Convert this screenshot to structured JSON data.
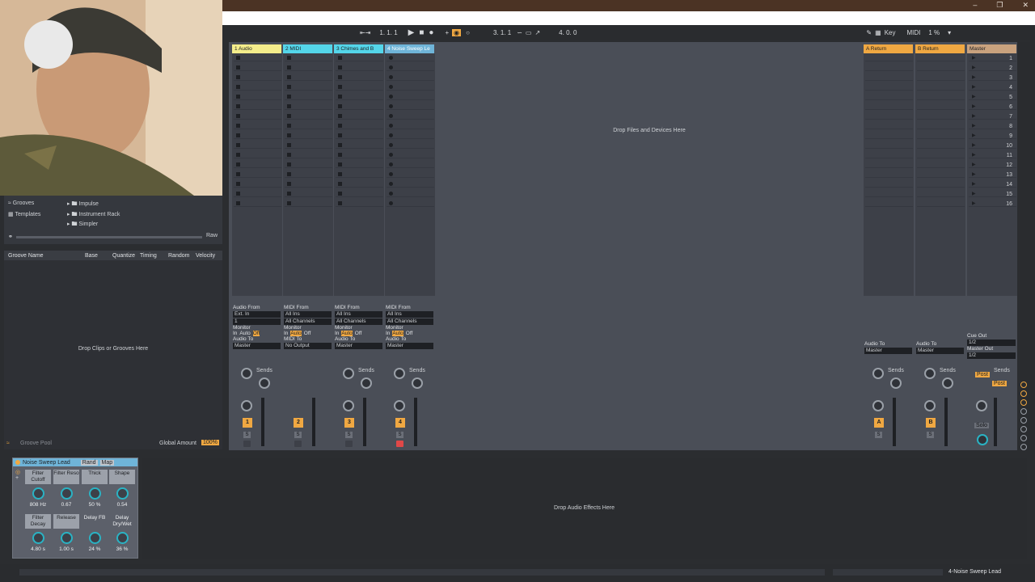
{
  "transport": {
    "position": "1.  1.  1",
    "loop_start": "3.  1.  1",
    "loop_len": "4.  0.  0",
    "key_label": "Key",
    "midi_label": "MIDI",
    "cpu": "1 %"
  },
  "tracks": [
    {
      "name": "1 Audio",
      "color": "#f4ed8b",
      "io_from": "Audio From",
      "from_val": "Ext. In",
      "sub": "1",
      "monitor": "Monitor",
      "mon_in": "In",
      "mon_auto": "Auto",
      "mon_off": "Off",
      "to_label": "Audio To",
      "to_val": "Master",
      "num": "1",
      "solo": "S",
      "sends": "Sends"
    },
    {
      "name": "2 MIDI",
      "color": "#54d6ea",
      "io_from": "MIDI From",
      "from_val": "All Ins",
      "sub": "All Channels",
      "monitor": "Monitor",
      "mon_in": "In",
      "mon_auto": "Auto",
      "mon_off": "Off",
      "to_label": "MIDI To",
      "to_val": "No Output",
      "num": "2",
      "solo": "S",
      "sends": ""
    },
    {
      "name": "3 Chimes and B",
      "color": "#54d6ea",
      "io_from": "MIDI From",
      "from_val": "All Ins",
      "sub": "All Channels",
      "monitor": "Monitor",
      "mon_in": "In",
      "mon_auto": "Auto",
      "mon_off": "Off",
      "to_label": "Audio To",
      "to_val": "Master",
      "num": "3",
      "solo": "S",
      "sends": "Sends"
    },
    {
      "name": "4 Noise Sweep Le",
      "color": "#6fb4d8",
      "io_from": "MIDI From",
      "from_val": "All Ins",
      "sub": "All Channels",
      "monitor": "Monitor",
      "mon_in": "In",
      "mon_auto": "Auto",
      "mon_off": "Off",
      "to_label": "Audio To",
      "to_val": "Master",
      "num": "4",
      "solo": "S",
      "sends": "Sends"
    }
  ],
  "returns": [
    {
      "name": "A Return",
      "color": "#f0a842",
      "to_label": "Audio To",
      "to_val": "Master",
      "num": "A",
      "solo": "S",
      "sends": "Sends"
    },
    {
      "name": "B Return",
      "color": "#f0a842",
      "to_label": "Audio To",
      "to_val": "Master",
      "num": "B",
      "solo": "S",
      "sends": "Sends"
    }
  ],
  "master": {
    "name": "Master",
    "color": "#c9a27e",
    "cue_label": "Cue Out",
    "cue_val": "1/2",
    "out_label": "Master Out",
    "out_val": "1/2",
    "sends": "Sends",
    "post1": "Post",
    "post2": "Post",
    "solo": "Solo"
  },
  "scenes": [
    "1",
    "2",
    "3",
    "4",
    "5",
    "6",
    "7",
    "8",
    "9",
    "10",
    "11",
    "12",
    "13",
    "14",
    "15",
    "16"
  ],
  "drop_files": "Drop Files and Devices Here",
  "browser": {
    "items_left": [
      "Grooves",
      "Templates"
    ],
    "items_right": [
      "Impulse",
      "Instrument Rack",
      "Simpler"
    ],
    "raw": "Raw"
  },
  "groove": {
    "cols": [
      "Groove Name",
      "Base",
      "Quantize",
      "Timing",
      "Random",
      "Velocity"
    ],
    "drop": "Drop Clips or Grooves Here",
    "pool": "Groove Pool",
    "global_label": "Global Amount",
    "global_val": "100%"
  },
  "device": {
    "name": "Noise Sweep Lead",
    "rand": "Rand",
    "map": "Map",
    "macros": [
      {
        "label": "Filter Cutoff",
        "value": "808 Hz"
      },
      {
        "label": "Filter Reso",
        "value": "0.67"
      },
      {
        "label": "Thick",
        "value": "50 %"
      },
      {
        "label": "Shape",
        "value": "0.54"
      },
      {
        "label": "Filter Decay",
        "value": "4.80 s"
      },
      {
        "label": "Release",
        "value": "1.00 s"
      },
      {
        "label": "Delay FB",
        "value": "24 %"
      },
      {
        "label": "Delay Dry/Wet",
        "value": "36 %"
      }
    ]
  },
  "drop_effects": "Drop Audio Effects Here",
  "status_track": "4-Noise Sweep Lead"
}
